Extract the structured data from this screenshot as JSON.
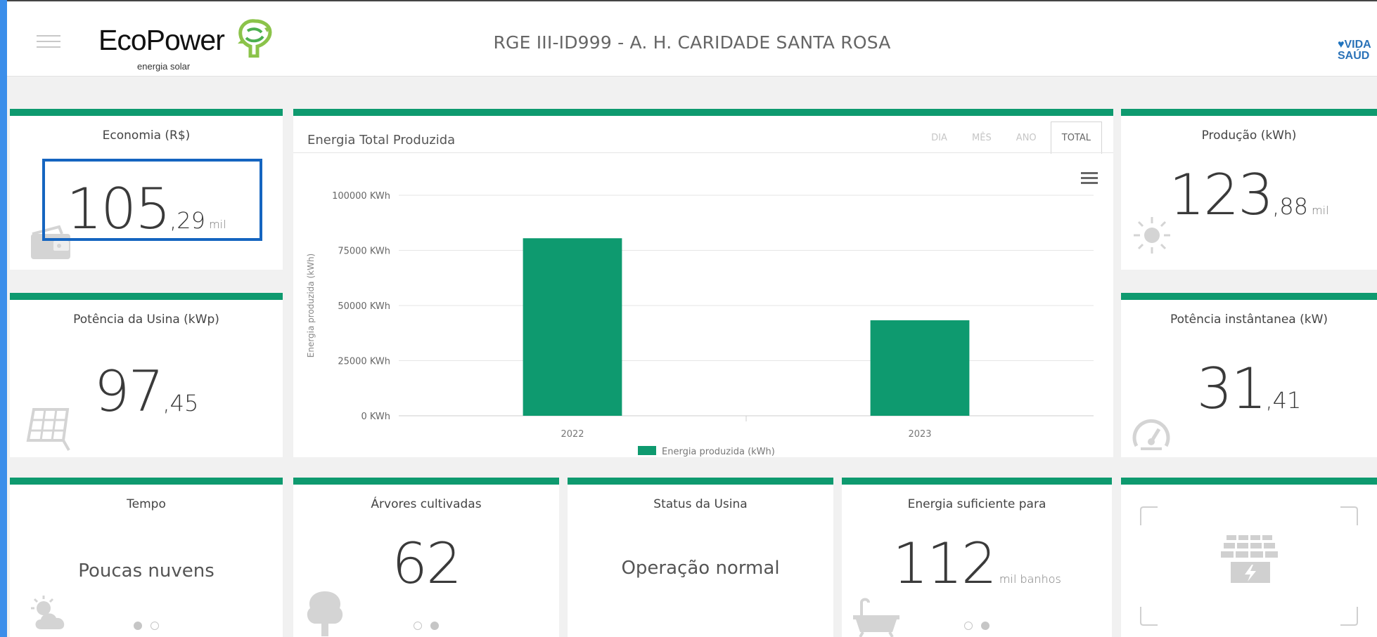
{
  "header": {
    "logo_word": "EcoPower",
    "logo_sub": "energia solar",
    "site_title": "RGE III-ID999 - A. H. CARIDADE SANTA ROSA",
    "partner_top": "VIDA",
    "partner_bottom": "SAÚD"
  },
  "cards": {
    "economia": {
      "title": "Economia (R$)",
      "int": "105",
      "dec": ",29",
      "unit": "mil",
      "icon": "wallet-icon"
    },
    "potencia_usina": {
      "title": "Potência da Usina (kWp)",
      "int": "97",
      "dec": ",45",
      "icon": "solar-panel-icon"
    },
    "producao": {
      "title": "Produção (kWh)",
      "int": "123",
      "dec": ",88",
      "unit": "mil",
      "icon": "sun-icon"
    },
    "potencia_inst": {
      "title": "Potência instântanea (kW)",
      "int": "31",
      "dec": ",41",
      "icon": "speedometer-icon"
    },
    "tempo": {
      "title": "Tempo",
      "text": "Poucas nuvens",
      "icon": "partly-cloudy-icon"
    },
    "arvores": {
      "title": "Árvores cultivadas",
      "int": "62",
      "icon": "tree-icon"
    },
    "status": {
      "title": "Status da Usina",
      "text": "Operação normal"
    },
    "energia_suficiente": {
      "title": "Energia suficiente para",
      "int": "112",
      "unit": "mil banhos",
      "icon": "bathtub-icon"
    },
    "painel": {
      "icon": "solar-panel-bolt-icon"
    }
  },
  "chart": {
    "title": "Energia Total Produzida",
    "tabs": [
      {
        "label": "DIA",
        "active": false
      },
      {
        "label": "MÊS",
        "active": false
      },
      {
        "label": "ANO",
        "active": false
      },
      {
        "label": "TOTAL",
        "active": true
      }
    ],
    "menu_icon": "hamburger-icon"
  },
  "chart_data": {
    "type": "bar",
    "categories": [
      "2022",
      "2023"
    ],
    "series": [
      {
        "name": "Energia produzida (kWh)",
        "values": [
          80500,
          43300
        ],
        "color": "#0e9a6f"
      }
    ],
    "xlabel": "",
    "ylabel": "Energia produzida (kWh)",
    "ylim": [
      0,
      100000
    ],
    "yticks": [
      0,
      25000,
      50000,
      75000,
      100000
    ],
    "ytick_labels": [
      "0 KWh",
      "25000 KWh",
      "50000 KWh",
      "75000 KWh",
      "100000 KWh"
    ],
    "grid": true,
    "legend": "bottom-center"
  },
  "colors": {
    "accent": "#0e9a6f",
    "highlight": "#1565c0",
    "icon_gray": "#d4d4d4"
  }
}
